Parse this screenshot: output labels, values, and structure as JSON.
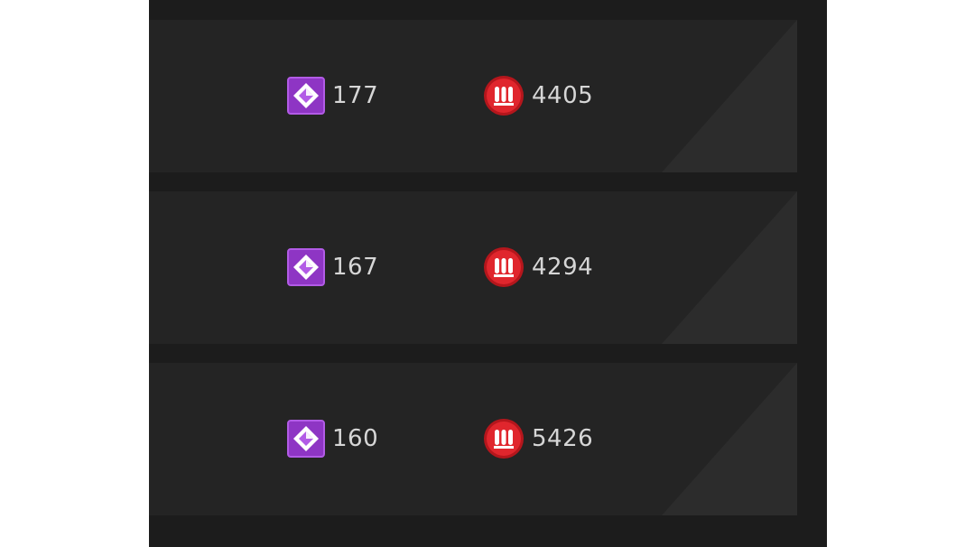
{
  "rows": [
    {
      "gems": {
        "icon": "purple-diamond-icon",
        "value": "177"
      },
      "ammo": {
        "icon": "red-ammo-icon",
        "value": "4405"
      }
    },
    {
      "gems": {
        "icon": "purple-diamond-icon",
        "value": "167"
      },
      "ammo": {
        "icon": "red-ammo-icon",
        "value": "4294"
      }
    },
    {
      "gems": {
        "icon": "purple-diamond-icon",
        "value": "160"
      },
      "ammo": {
        "icon": "red-ammo-icon",
        "value": "5426"
      }
    }
  ],
  "colors": {
    "panel_background": "#1c1c1c",
    "row_background": "#242424",
    "gem_purple": "#9b3fd0",
    "ammo_red": "#d81f26",
    "value_text": "#d6d6d6"
  }
}
